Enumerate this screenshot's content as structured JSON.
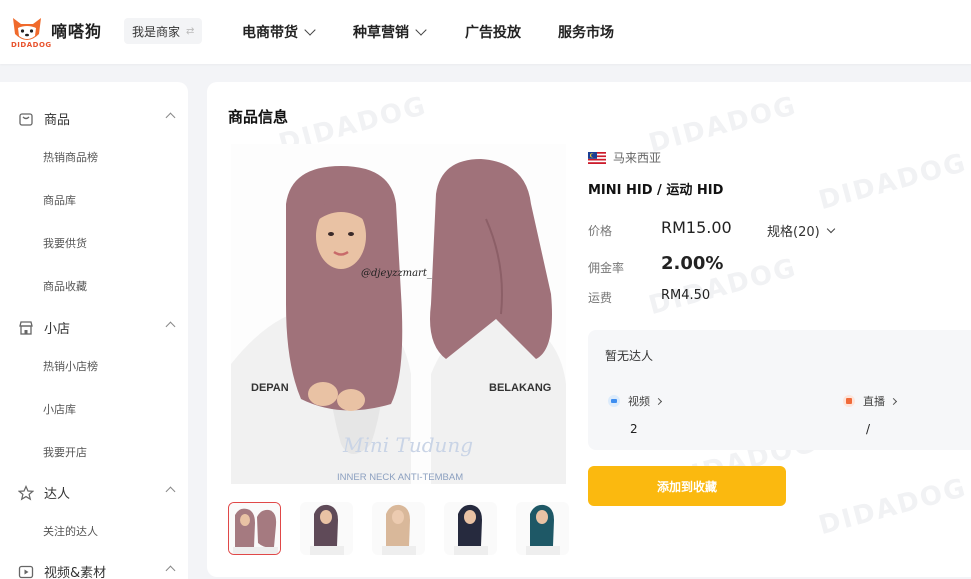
{
  "brand": {
    "name": "嘀嗒狗",
    "sub": "DIDADOG"
  },
  "merchant_switch": "我是商家",
  "nav": [
    {
      "label": "电商带货",
      "dropdown": true
    },
    {
      "label": "种草营销",
      "dropdown": true
    },
    {
      "label": "广告投放",
      "dropdown": false
    },
    {
      "label": "服务市场",
      "dropdown": false
    }
  ],
  "sidebar": {
    "groups": [
      {
        "label": "商品",
        "icon": "bag-icon",
        "items": [
          "热销商品榜",
          "商品库",
          "我要供货",
          "商品收藏"
        ]
      },
      {
        "label": "小店",
        "icon": "store-icon",
        "items": [
          "热销小店榜",
          "小店库",
          "我要开店"
        ]
      },
      {
        "label": "达人",
        "icon": "star-icon",
        "items": [
          "关注的达人"
        ]
      },
      {
        "label": "视频&素材",
        "icon": "video-icon",
        "items": []
      }
    ]
  },
  "main": {
    "title": "商品信息",
    "watermark": "DIDADOG",
    "image_text": {
      "handle": "@djeyzzmart_",
      "front": "DEPAN",
      "back": "BELAKANG",
      "script": "Mini Tudung",
      "caption": "INNER NECK ANTI-TEMBAM"
    },
    "thumbnail_colors": [
      "#a57a80",
      "#5f4a58",
      "#d9b89a",
      "#262a3e",
      "#1e5866"
    ]
  },
  "product": {
    "country": "马来西亚",
    "name": "MINI HID / 运动 HID",
    "price_label": "价格",
    "price": "RM15.00",
    "spec": "规格(20)",
    "commission_label": "佣金率",
    "commission": "2.00%",
    "shipping_label": "运费",
    "shipping": "RM4.50",
    "kol_title": "暂无达人",
    "video_label": "视频",
    "video_count": "2",
    "live_label": "直播",
    "live_count": "/",
    "add_button": "添加到收藏"
  },
  "colors": {
    "accent": "#fbb90f",
    "hijab": "#a0727a",
    "active_border": "#e04848"
  }
}
